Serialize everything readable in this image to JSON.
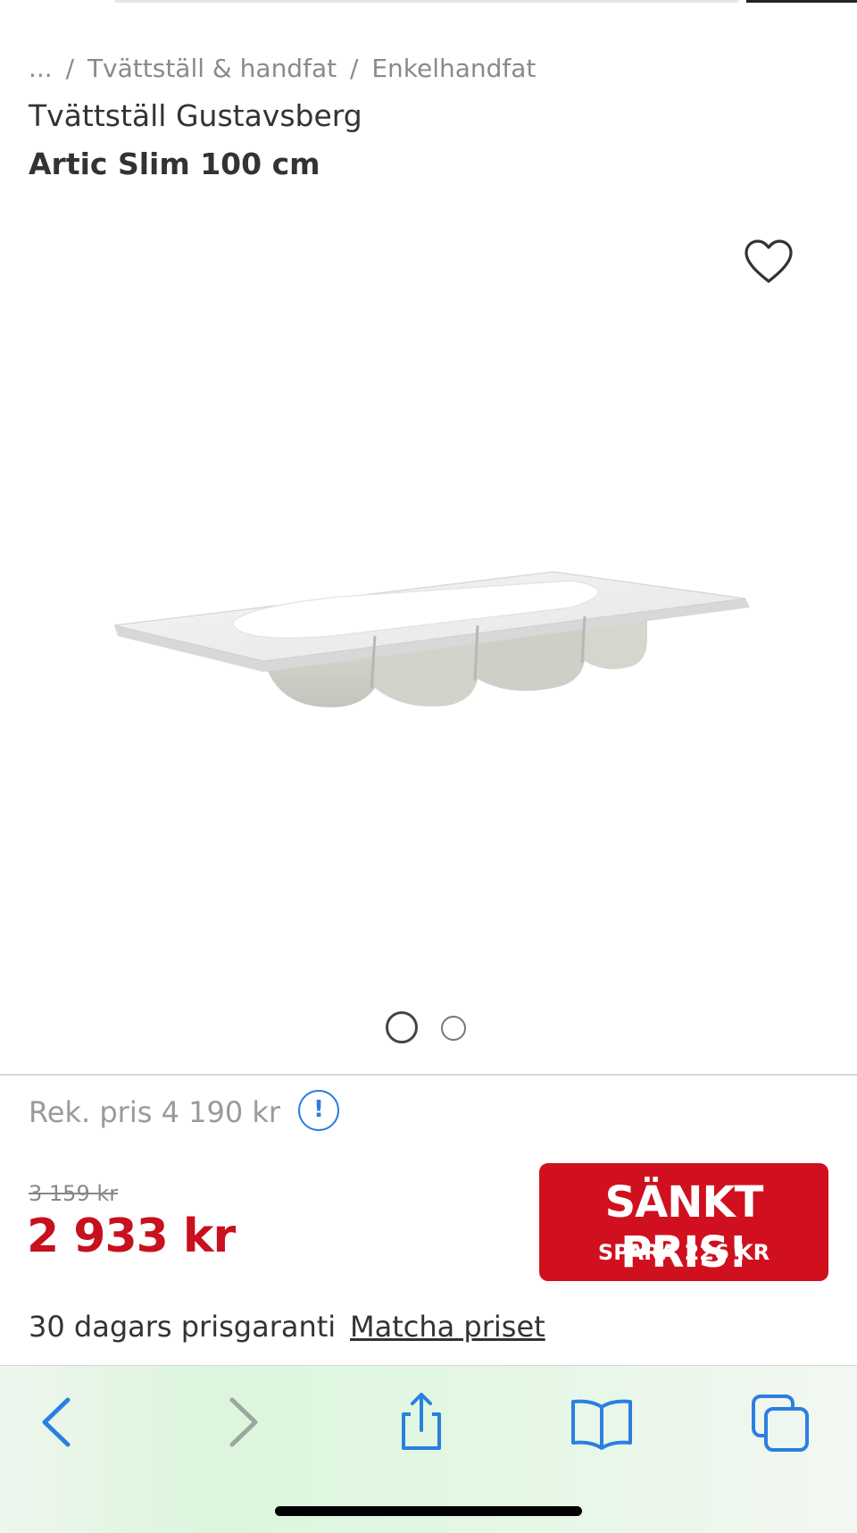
{
  "breadcrumb": {
    "ellipsis": "...",
    "sep1": "/",
    "level1": "Tvättställ & handfat",
    "sep2": "/",
    "level2": "Enkelhandfat"
  },
  "product": {
    "brand_line": "Tvättställ Gustavsberg",
    "model_line": "Artic Slim 100 cm",
    "image_icon": "washbasin-image",
    "gallery": {
      "count": 2,
      "active_index": 0
    }
  },
  "pricing": {
    "recommended_label": "Rek. pris 4 190 kr",
    "info_icon_glyph": "!",
    "old_price": "3 159 kr",
    "new_price": "2 933 kr",
    "badge_title": "SÄNKT PRIS!",
    "badge_subtitle": "SPARA 226 KR",
    "badge_color": "#d0101f",
    "price_color": "#c8101e"
  },
  "guarantee": {
    "text": "30 dagars prisgaranti",
    "link": "Matcha priset"
  },
  "browser_toolbar": {
    "icons": [
      "back-icon",
      "forward-icon",
      "share-icon",
      "bookmarks-icon",
      "tabs-icon"
    ],
    "accent": "#2b7fe0"
  }
}
